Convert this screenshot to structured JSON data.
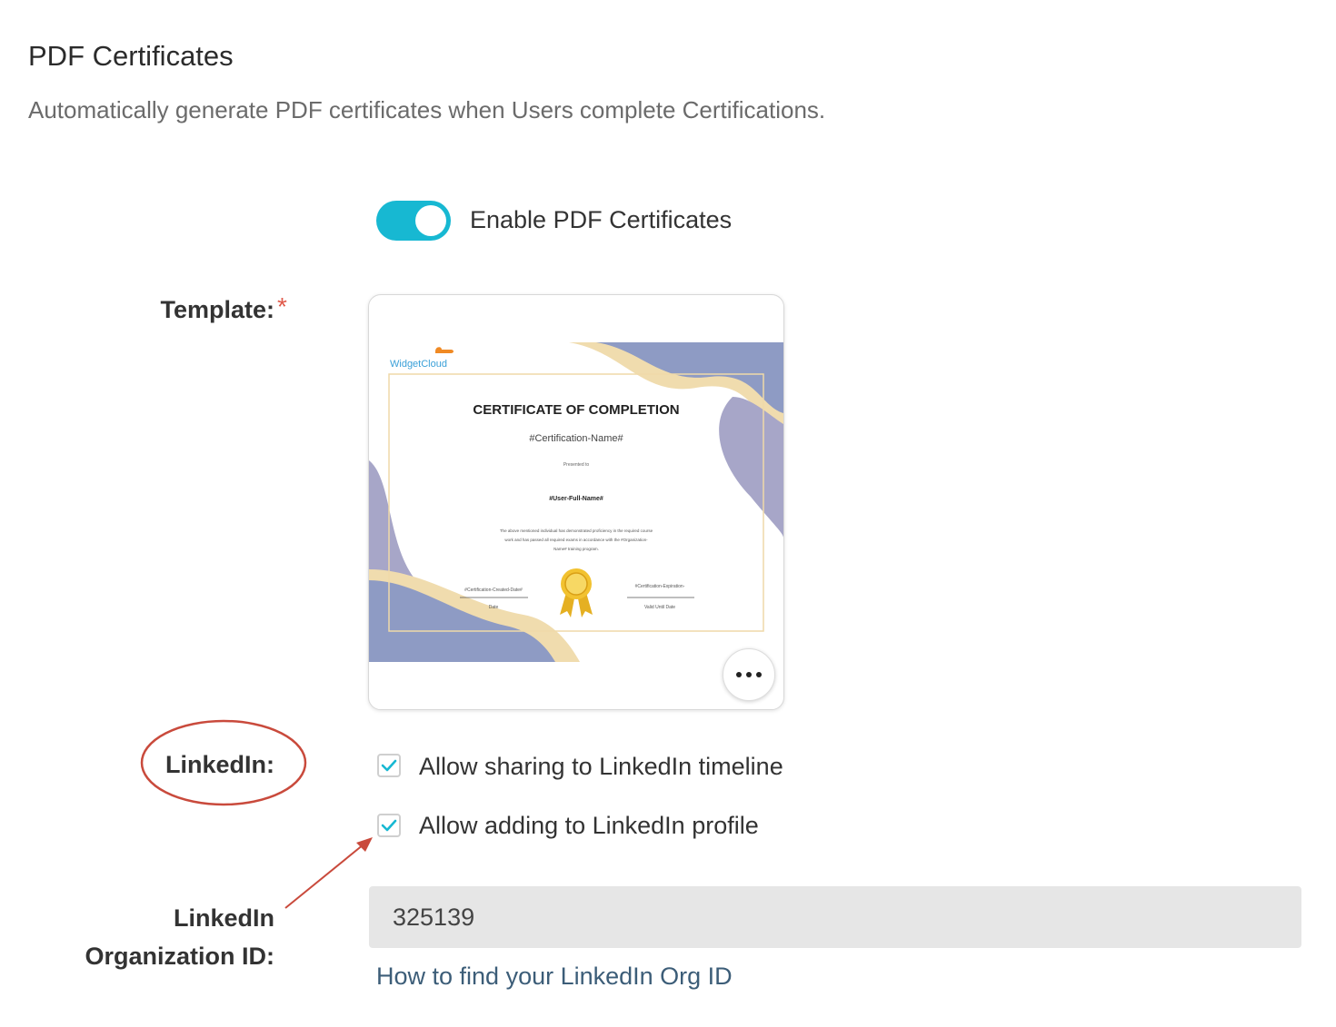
{
  "section": {
    "title": "PDF Certificates",
    "description": "Automatically generate PDF certificates when Users complete Certifications."
  },
  "toggle": {
    "label": "Enable PDF Certificates",
    "enabled": true,
    "color": "#17b8d2"
  },
  "template": {
    "label": "Template:",
    "required_marker": "*",
    "preview": {
      "logo_text": "WidgetCloud",
      "heading": "CERTIFICATE OF COMPLETION",
      "certification_name": "#Certification-Name#",
      "presented_to": "Presented to",
      "user_name": "#User-Full-Name#",
      "body_line1": "The above mentioned individual has demonstrated proficiency in the required course",
      "body_line2": "work and has passed all required exams in accordance with the #Organization-",
      "body_line3": "Name# training program.",
      "created_date": "#Certification-Created-Date#",
      "date_label": "Date",
      "expiration": "#Certification-Expiration-",
      "valid_label": "Valid Until Date"
    },
    "more_icon": "more-horizontal-icon"
  },
  "linkedin": {
    "label": "LinkedIn:",
    "options": [
      {
        "label": "Allow sharing to LinkedIn timeline",
        "checked": true
      },
      {
        "label": "Allow adding to LinkedIn profile",
        "checked": true
      }
    ]
  },
  "org_id": {
    "label_line1": "LinkedIn",
    "label_line2": "Organization ID:",
    "value": "325139",
    "help_link": "How to find your LinkedIn Org ID"
  },
  "colors": {
    "accent": "#17b8d2",
    "annotation": "#c94a3c",
    "input_bg": "#e6e6e6"
  }
}
